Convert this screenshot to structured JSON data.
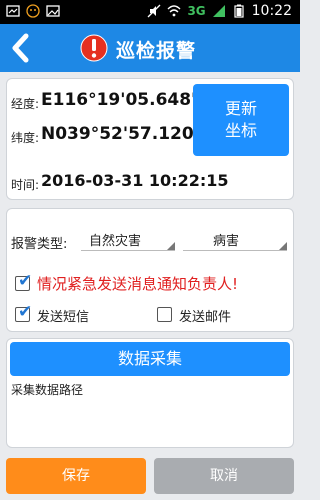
{
  "status_bar": {
    "network": "3G",
    "time": "10:22"
  },
  "header": {
    "title": "巡检报警"
  },
  "location": {
    "longitude_label": "经度:",
    "longitude": "E116°19'05.648\"",
    "latitude_label": "纬度:",
    "latitude": "N039°52'57.120\"",
    "time_label": "时间:",
    "time": "2016-03-31 10:22:15",
    "update_button": "更新\n坐标"
  },
  "alarm": {
    "type_label": "报警类型:",
    "type_value": "自然灾害",
    "subtype_value": "病害",
    "urgent_label": "情况紧急发送消息通知负责人!",
    "urgent_checked": true,
    "sms_label": "发送短信",
    "sms_checked": true,
    "email_label": "发送邮件",
    "email_checked": false
  },
  "data_collection": {
    "button": "数据采集",
    "path_label": "采集数据路径"
  },
  "footer": {
    "save": "保存",
    "cancel": "取消"
  },
  "colors": {
    "primary": "#1e88e5",
    "save": "#ff8c1a",
    "cancel": "#a9acb0",
    "urgent_text": "#e02020"
  }
}
